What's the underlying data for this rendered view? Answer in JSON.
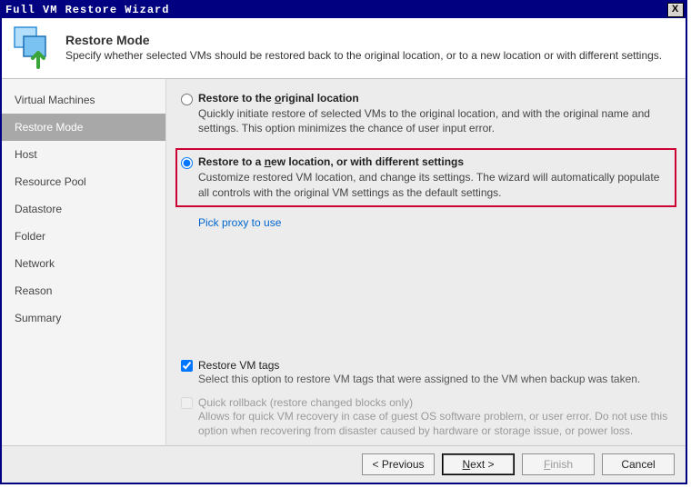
{
  "window": {
    "title": "Full VM Restore Wizard",
    "close_glyph": "X"
  },
  "header": {
    "title": "Restore Mode",
    "description": "Specify whether selected VMs should be restored back to the original location, or to a new location or with different settings."
  },
  "sidebar": {
    "items": [
      "Virtual Machines",
      "Restore Mode",
      "Host",
      "Resource Pool",
      "Datastore",
      "Folder",
      "Network",
      "Reason",
      "Summary"
    ],
    "active_index": 1
  },
  "options": {
    "original": {
      "label_before": "Restore to the ",
      "label_underlined": "o",
      "label_after": "riginal location",
      "description": "Quickly initiate restore of selected VMs to the original location, and with the original name and settings. This option minimizes the chance of user input error."
    },
    "newloc": {
      "label_before": "Restore to a ",
      "label_underlined": "n",
      "label_after": "ew location, or with different settings",
      "description": "Customize restored VM location, and change its settings. The wizard will automatically populate all controls with the original VM settings as the default settings."
    },
    "pick_proxy": "Pick proxy to use"
  },
  "checks": {
    "tags": {
      "label": "Restore VM tags",
      "description": "Select this option to restore VM tags that were assigned to the VM when backup was taken."
    },
    "rollback": {
      "label": "Quick rollback (restore changed blocks only)",
      "description": "Allows for quick VM recovery in case of guest OS software problem, or user error. Do not use this option when recovering from disaster caused by hardware or storage issue, or power loss."
    }
  },
  "footer": {
    "previous": "< Previous",
    "next_before": "",
    "next_underlined": "N",
    "next_after": "ext >",
    "finish_before": "",
    "finish_underlined": "F",
    "finish_after": "inish",
    "cancel": "Cancel"
  }
}
